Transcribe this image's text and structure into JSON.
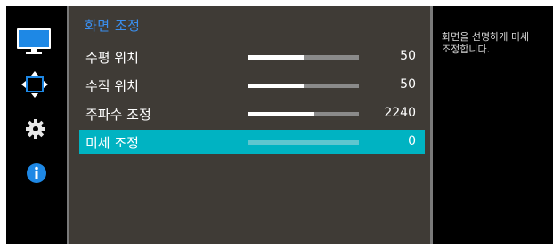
{
  "sidebar": {
    "icons": [
      {
        "name": "picture-icon"
      },
      {
        "name": "screen-position-icon",
        "active": true
      },
      {
        "name": "settings-gear-icon"
      },
      {
        "name": "information-icon"
      }
    ]
  },
  "menu": {
    "title": "화면 조정",
    "items": [
      {
        "label": "수평 위치",
        "value": "50",
        "level": 0.5,
        "selected": false
      },
      {
        "label": "수직 위치",
        "value": "50",
        "level": 0.5,
        "selected": false
      },
      {
        "label": "주파수 조정",
        "value": "2240",
        "level": 0.6,
        "selected": false
      },
      {
        "label": "미세 조정",
        "value": "0",
        "level": 0.0,
        "selected": true
      }
    ]
  },
  "help": {
    "text": "화면을 선명하게 미세 조정합니다."
  },
  "colors": {
    "title": "#3a8ff0",
    "selected_row": "#00b3c2",
    "panel_bg": "#3f3b36",
    "side_bg": "#000000"
  }
}
